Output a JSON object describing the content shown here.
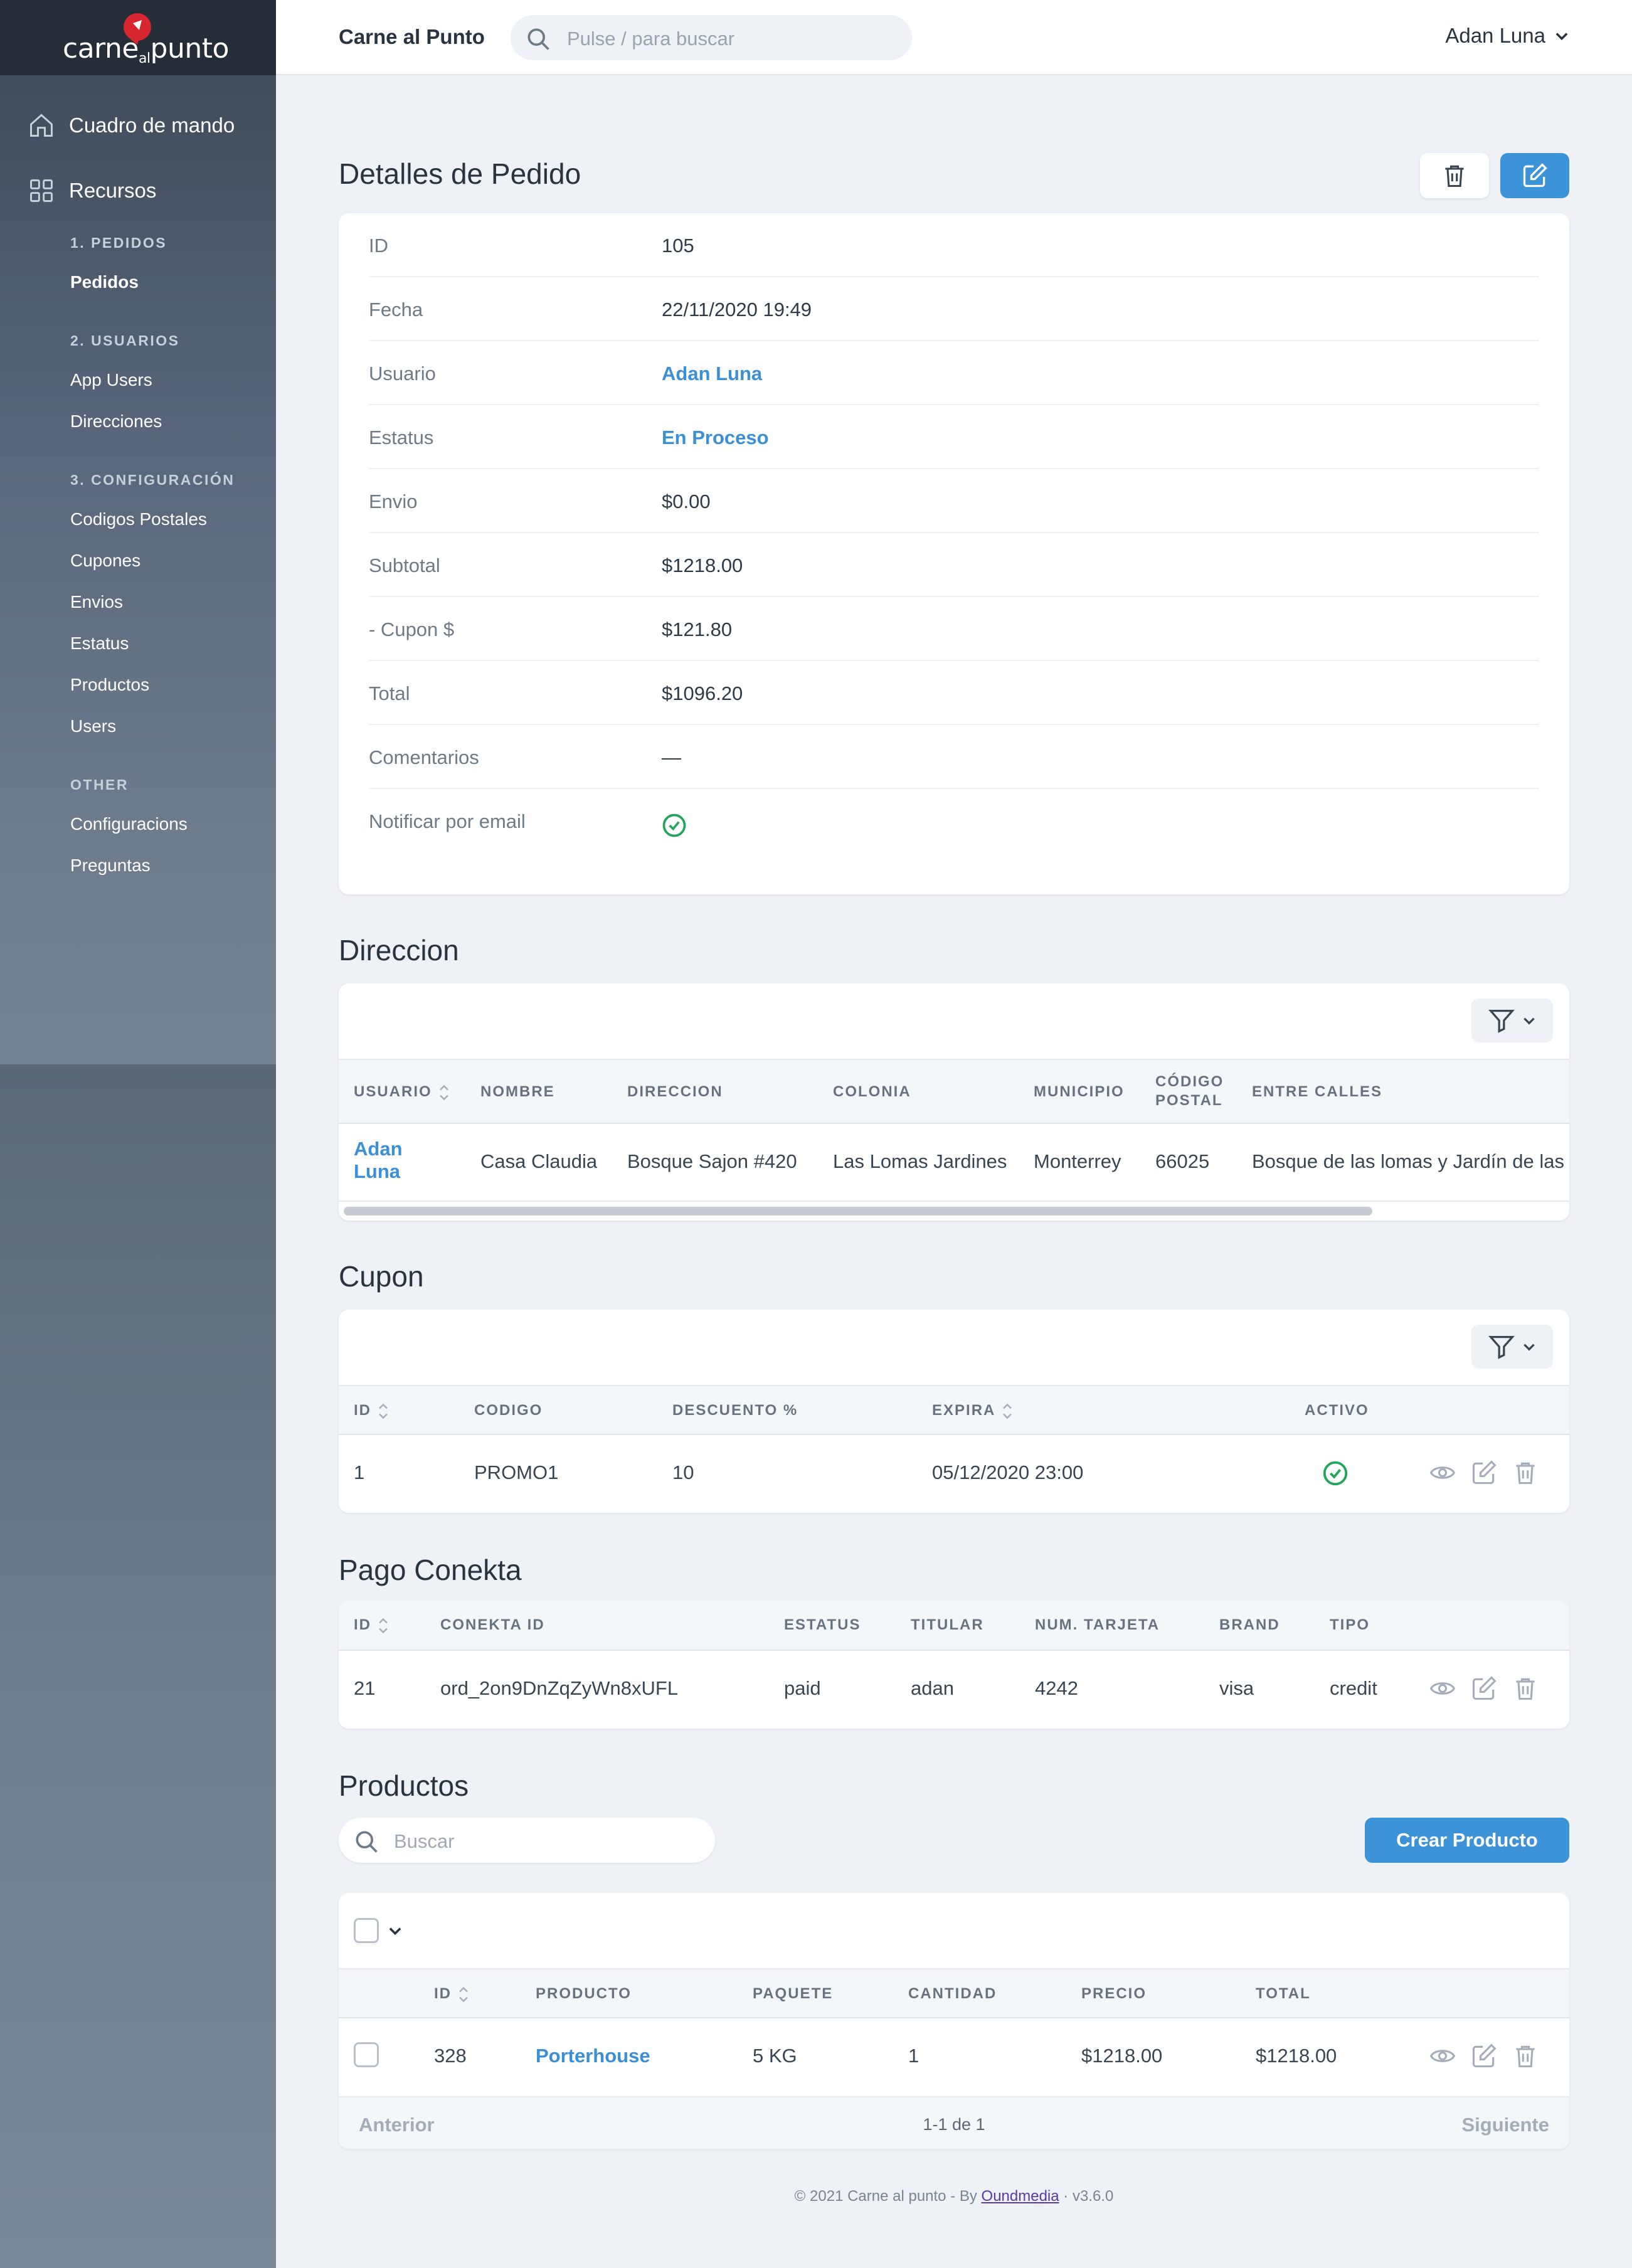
{
  "brand": {
    "logo_text_main": "carne",
    "logo_text_al": "al",
    "logo_text_end": "punto"
  },
  "sidebar": {
    "dashboard": "Cuadro de mando",
    "resources": "Recursos",
    "groups": [
      {
        "heading": "1. PEDIDOS",
        "items": [
          "Pedidos"
        ]
      },
      {
        "heading": "2. USUARIOS",
        "items": [
          "App Users",
          "Direcciones"
        ]
      },
      {
        "heading": "3. CONFIGURACIÓN",
        "items": [
          "Codigos Postales",
          "Cupones",
          "Envios",
          "Estatus",
          "Productos",
          "Users"
        ]
      },
      {
        "heading": "OTHER",
        "items": [
          "Configuracions",
          "Preguntas"
        ]
      }
    ],
    "active_item": "Pedidos"
  },
  "topbar": {
    "app_name": "Carne al Punto",
    "search_placeholder": "Pulse / para buscar",
    "user_name": "Adan Luna"
  },
  "details": {
    "title": "Detalles de Pedido",
    "rows": [
      {
        "label": "ID",
        "value": "105"
      },
      {
        "label": "Fecha",
        "value": "22/11/2020 19:49"
      },
      {
        "label": "Usuario",
        "value": "Adan Luna"
      },
      {
        "label": "Estatus",
        "value": "En Proceso"
      },
      {
        "label": "Envio",
        "value": "$0.00"
      },
      {
        "label": "Subtotal",
        "value": "$1218.00"
      },
      {
        "label": "- Cupon $",
        "value": "$121.80"
      },
      {
        "label": "Total",
        "value": "$1096.20"
      },
      {
        "label": "Comentarios",
        "value": "—"
      },
      {
        "label": "Notificar por email",
        "value": ""
      }
    ]
  },
  "direccion": {
    "title": "Direccion",
    "headers": [
      "USUARIO",
      "NOMBRE",
      "DIRECCION",
      "COLONIA",
      "MUNICIPIO",
      "CÓDIGO",
      "POSTAL",
      "ENTRE CALLES"
    ],
    "row": {
      "usuario_1": "Adan",
      "usuario_2": "Luna",
      "nombre": "Casa Claudia",
      "direccion": "Bosque Sajon #420",
      "colonia": "Las Lomas Jardines",
      "municipio": "Monterrey",
      "cp": "66025",
      "entre": "Bosque de las lomas y Jardín de las"
    }
  },
  "cupon": {
    "title": "Cupon",
    "headers": [
      "ID",
      "CODIGO",
      "DESCUENTO %",
      "EXPIRA",
      "ACTIVO"
    ],
    "row": {
      "id": "1",
      "codigo": "PROMO1",
      "descuento": "10",
      "expira": "05/12/2020 23:00"
    }
  },
  "pago": {
    "title": "Pago Conekta",
    "headers": [
      "ID",
      "CONEKTA ID",
      "ESTATUS",
      "TITULAR",
      "NUM. TARJETA",
      "BRAND",
      "TIPO"
    ],
    "row": {
      "id": "21",
      "conekta_id": "ord_2on9DnZqZyWn8xUFL",
      "estatus": "paid",
      "titular": "adan",
      "tarjeta": "4242",
      "brand": "visa",
      "tipo": "credit"
    }
  },
  "productos": {
    "title": "Productos",
    "search_placeholder": "Buscar",
    "create_label": "Crear Producto",
    "headers": [
      "ID",
      "PRODUCTO",
      "PAQUETE",
      "CANTIDAD",
      "PRECIO",
      "TOTAL"
    ],
    "row": {
      "id": "328",
      "producto": "Porterhouse",
      "paquete": "5 KG",
      "cantidad": "1",
      "precio": "$1218.00",
      "total": "$1218.00"
    },
    "pager": {
      "prev": "Anterior",
      "count": "1-1 de 1",
      "next": "Siguiente"
    }
  },
  "footer": {
    "prefix": "© 2021 Carne al punto - By ",
    "link": "Oundmedia",
    "suffix": " · v3.6.0"
  },
  "colors": {
    "accent": "#3d93d8",
    "success": "#21a55a",
    "brand_red": "#d8262e"
  }
}
